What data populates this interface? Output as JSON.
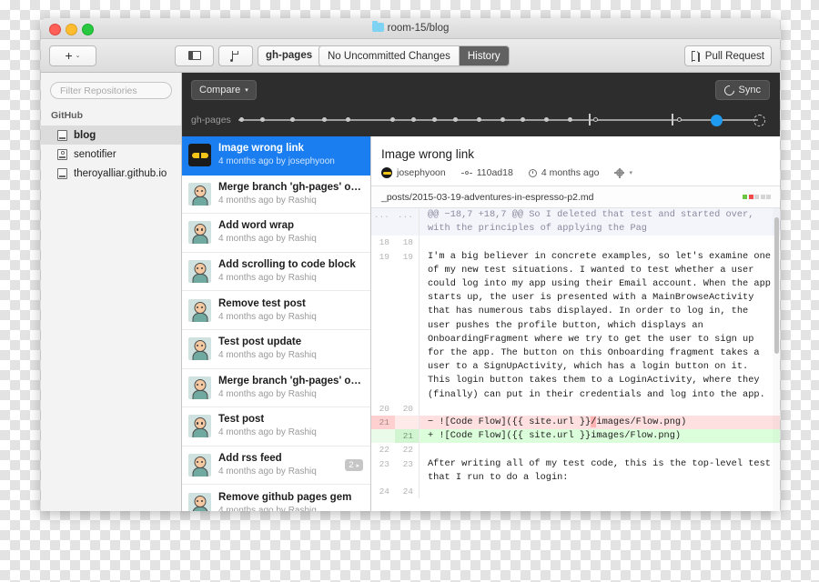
{
  "window": {
    "title": "room-15/blog",
    "folder_icon": "folder-icon",
    "traffic_lights": [
      "close",
      "minimize",
      "zoom"
    ]
  },
  "toolbar": {
    "add_label": "+",
    "add_caret": "⌄",
    "panel_icon": "sidebar-toggle-icon",
    "branch_icon": "branch-icon",
    "branch_name": "gh-pages",
    "branch_caret": "⌄",
    "uncommitted_label": "No Uncommitted Changes",
    "history_label": "History",
    "pull_request_label": "Pull Request",
    "pull_request_icon": "pull-request-icon"
  },
  "sidebar": {
    "filter_placeholder": "Filter Repositories",
    "section_label": "GitHub",
    "repos": [
      {
        "name": "blog",
        "selected": true,
        "icon": "repo-icon"
      },
      {
        "name": "senotifier",
        "selected": false,
        "icon": "repo-icon-alt"
      },
      {
        "name": "theroyalliar.github.io",
        "selected": false,
        "icon": "repo-icon"
      }
    ]
  },
  "compare_bar": {
    "compare_label": "Compare",
    "compare_caret": "▾",
    "sync_label": "Sync",
    "sync_icon": "sync-icon",
    "timeline_label": "gh-pages"
  },
  "timeline": {
    "dots_pct": [
      1,
      8,
      18,
      29,
      37,
      52,
      59,
      66,
      73,
      81,
      89,
      96,
      104,
      112
    ],
    "marks_pct": [
      119,
      147
    ],
    "current_pct": 160,
    "end_marker": "dashed-circle"
  },
  "commits": [
    {
      "title": "Image wrong link",
      "meta": "4 months ago by josephyoon",
      "avatar": "dark-shades",
      "selected": true,
      "badge": null
    },
    {
      "title": "Merge branch 'gh-pages' of git…",
      "meta": "4 months ago by Rashiq",
      "avatar": "face",
      "selected": false,
      "badge": null
    },
    {
      "title": "Add word wrap",
      "meta": "4 months ago by Rashiq",
      "avatar": "face",
      "selected": false,
      "badge": null
    },
    {
      "title": "Add scrolling to code block",
      "meta": "4 months ago by Rashiq",
      "avatar": "face",
      "selected": false,
      "badge": null
    },
    {
      "title": "Remove test post",
      "meta": "4 months ago by Rashiq",
      "avatar": "face",
      "selected": false,
      "badge": null
    },
    {
      "title": "Test post update",
      "meta": "4 months ago by Rashiq",
      "avatar": "face",
      "selected": false,
      "badge": null
    },
    {
      "title": "Merge branch 'gh-pages' of git…",
      "meta": "4 months ago by Rashiq",
      "avatar": "face",
      "selected": false,
      "badge": null
    },
    {
      "title": "Test post",
      "meta": "4 months ago by Rashiq",
      "avatar": "face",
      "selected": false,
      "badge": null
    },
    {
      "title": "Add rss feed",
      "meta": "4 months ago by Rashiq",
      "avatar": "face",
      "selected": false,
      "badge": "2"
    },
    {
      "title": "Remove github pages gem",
      "meta": "4 months ago by Rashiq",
      "avatar": "face",
      "selected": false,
      "badge": null
    }
  ],
  "detail": {
    "title": "Image wrong link",
    "author": "josephyoon",
    "sha": "110ad18",
    "time": "4 months ago",
    "gear_icon": "gear-icon",
    "gear_caret": "▾",
    "file_name": "_posts/2015-03-19-adventures-in-espresso-p2.md",
    "diff_stat": [
      "#6cc644",
      "#f04b4b",
      "#d6d6d6",
      "#d6d6d6",
      "#d6d6d6"
    ]
  },
  "diff": {
    "lines": [
      {
        "type": "hunk",
        "old": "...",
        "new": "...",
        "text": "@@ −18,7 +18,7 @@ So I deleted that test and started over,\nwith the principles of applying the Pag"
      },
      {
        "type": "ctx",
        "old": "18",
        "new": "18",
        "text": ""
      },
      {
        "type": "ctx",
        "old": "19",
        "new": "19",
        "text": "I'm a big believer in concrete examples, so let's examine one\nof my new test situations. I wanted to test whether a user\ncould log into my app using their Email account. When the app\nstarts up, the user is presented with a MainBrowseActivity\nthat has numerous tabs displayed. In order to log in, the\nuser pushes the profile button, which displays an\nOnboardingFragment where we try to get the user to sign up\nfor the app. The button on this Onboarding fragment takes a\nuser to a SignUpActivity, which has a login button on it.\nThis login button takes them to a LoginActivity, where they\n(finally) can put in their credentials and log into the app."
      },
      {
        "type": "ctx",
        "old": "20",
        "new": "20",
        "text": ""
      },
      {
        "type": "del",
        "old": "21",
        "new": "",
        "text": "− ![Code Flow]({{ site.url }}/images/Flow.png)"
      },
      {
        "type": "ins",
        "old": "",
        "new": "21",
        "text": "+ ![Code Flow]({{ site.url }}images/Flow.png)"
      },
      {
        "type": "ctx",
        "old": "22",
        "new": "22",
        "text": ""
      },
      {
        "type": "ctx",
        "old": "23",
        "new": "23",
        "text": "After writing all of my test code, this is the top-level test\nthat I run to do a login:"
      },
      {
        "type": "ctx",
        "old": "24",
        "new": "24",
        "text": ""
      }
    ]
  }
}
